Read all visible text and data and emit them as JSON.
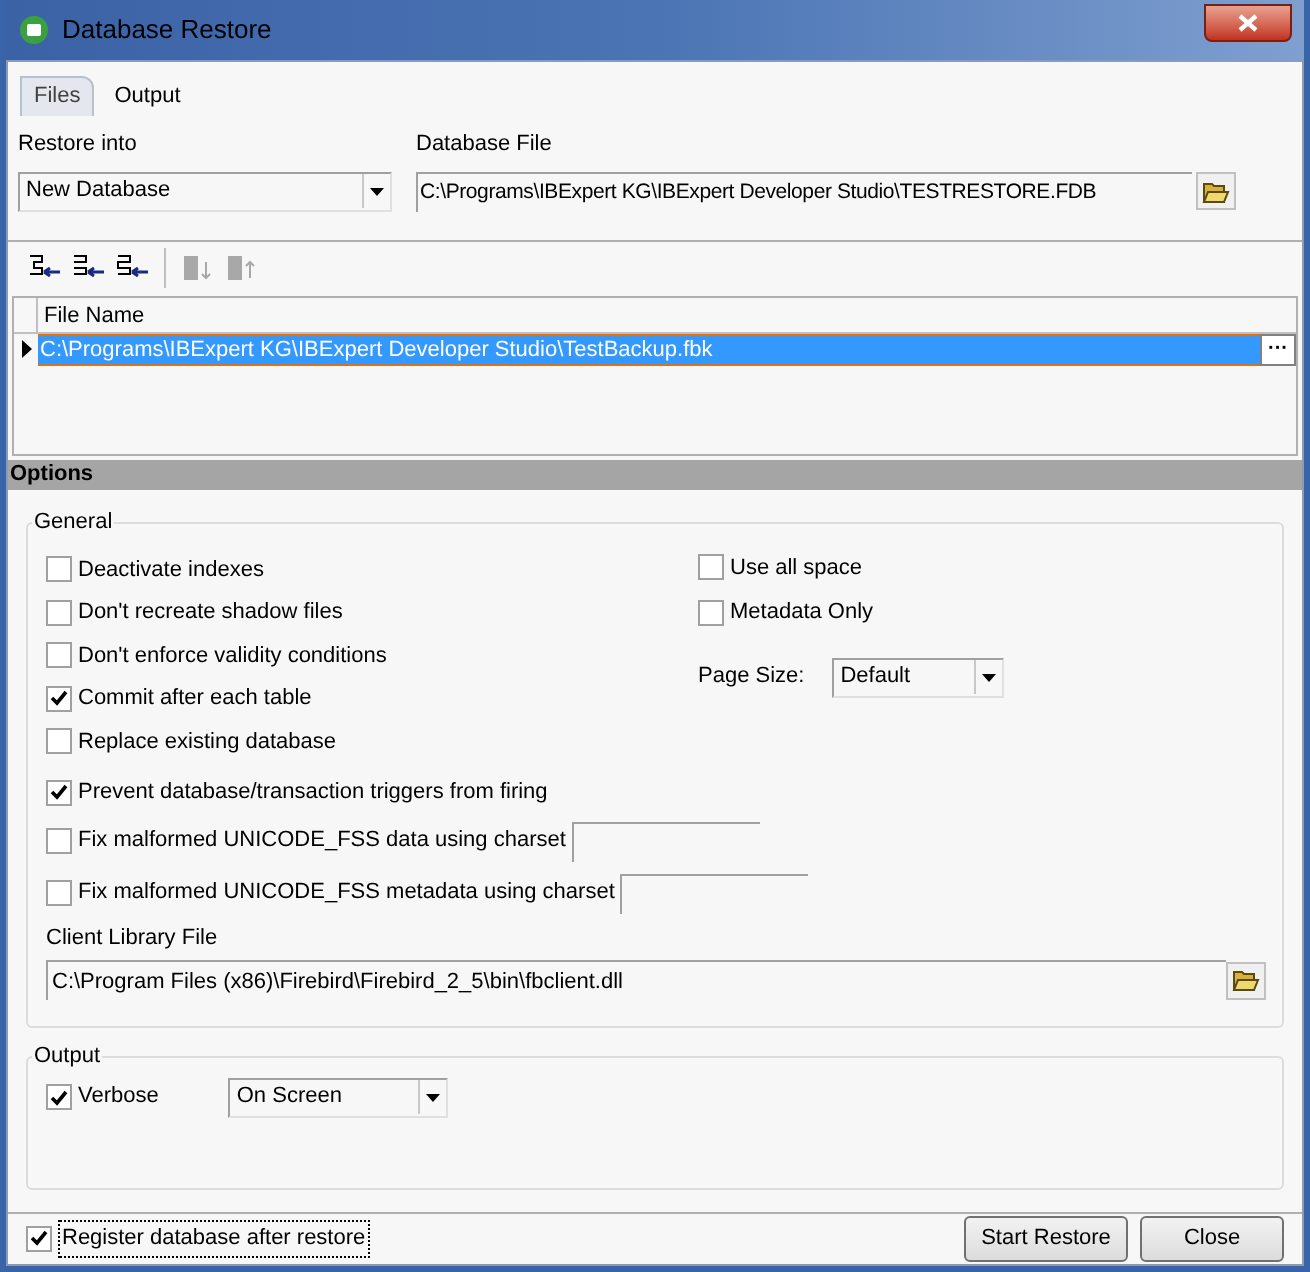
{
  "window": {
    "title": "Database Restore"
  },
  "tabs": [
    {
      "label": "Files",
      "selected": true
    },
    {
      "label": "Output",
      "selected": false
    }
  ],
  "restore_into": {
    "label": "Restore into",
    "value": "New Database"
  },
  "database_file": {
    "label": "Database File",
    "value": "C:\\Programs\\IBExpert KG\\IBExpert Developer Studio\\TESTRESTORE.FDB"
  },
  "toolbar": [
    {
      "kind": "add",
      "disabled": false
    },
    {
      "kind": "insert",
      "disabled": false
    },
    {
      "kind": "remove",
      "disabled": false
    },
    {
      "kind": "down",
      "disabled": true
    },
    {
      "kind": "up",
      "disabled": true
    }
  ],
  "file_grid": {
    "columns": [
      "File Name"
    ],
    "rows": [
      {
        "file": "C:\\Programs\\IBExpert KG\\IBExpert Developer Studio\\TestBackup.fbk",
        "selected": true,
        "button": "···"
      }
    ]
  },
  "options": {
    "title": "Options",
    "general": {
      "title": "General",
      "left": [
        {
          "kind": "check",
          "label": "Deactivate indexes",
          "checked": false
        },
        {
          "kind": "check",
          "label": "Don't recreate shadow files",
          "checked": false
        },
        {
          "kind": "check",
          "label": "Don't enforce validity conditions",
          "checked": false
        },
        {
          "kind": "check",
          "label": "Commit after each table",
          "checked": true
        },
        {
          "kind": "check",
          "label": "Replace existing database",
          "checked": false
        },
        {
          "kind": "check",
          "label": "Prevent database/transaction triggers from firing",
          "checked": true
        },
        {
          "kind": "check_field",
          "label": "Fix malformed UNICODE_FSS data using charset",
          "checked": false
        },
        {
          "kind": "check_field",
          "label": "Fix malformed UNICODE_FSS metadata using charset",
          "checked": false
        }
      ],
      "right": [
        {
          "label": "Use all space",
          "checked": false
        },
        {
          "label": "Metadata Only",
          "checked": false
        }
      ],
      "page_size": {
        "label": "Page Size:",
        "value": "Default"
      },
      "client_library": {
        "label": "Client Library File",
        "value": "C:\\Program Files (x86)\\Firebird\\Firebird_2_5\\bin\\fbclient.dll"
      }
    },
    "output": {
      "title": "Output",
      "verbose": {
        "label": "Verbose",
        "checked": true
      },
      "mode": "On Screen"
    }
  },
  "footer": {
    "register": {
      "label": "Register database after restore",
      "checked": true
    },
    "buttons": [
      "Start Restore",
      "Close"
    ]
  }
}
